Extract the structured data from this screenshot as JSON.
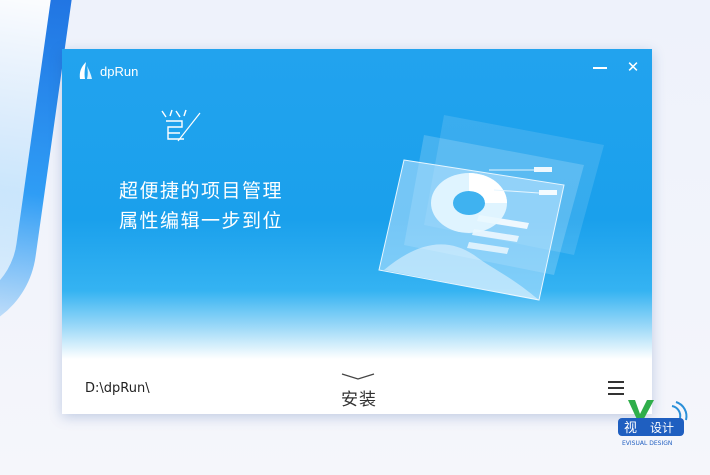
{
  "app": {
    "title": "dpRun",
    "minimize_icon": "minimize-icon",
    "close_symbol": "✕"
  },
  "hero": {
    "line1": "超便捷的项目管理",
    "line2": "属性编辑一步到位"
  },
  "footer": {
    "install_path": "D:\\dpRun\\",
    "install_label": "安装",
    "menu_icon": "hamburger-icon"
  },
  "badge": {
    "text_left": "视",
    "text_right": "设计",
    "sub": "EVISUAL DESIGN"
  },
  "colors": {
    "accent": "#1aa0ec",
    "desktop_blue": "#2f9df5"
  }
}
